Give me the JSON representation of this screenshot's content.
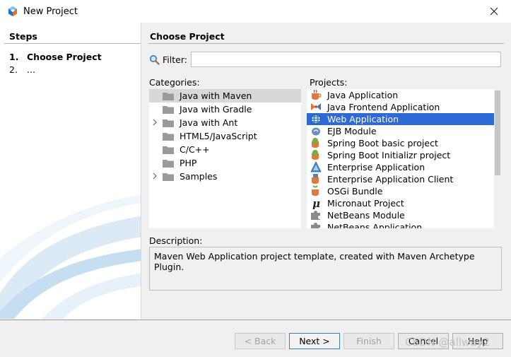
{
  "window": {
    "title": "New Project",
    "close_label": "✕"
  },
  "steps": {
    "header": "Steps",
    "items": [
      {
        "num": "1.",
        "label": "Choose Project"
      },
      {
        "num": "2.",
        "label": "..."
      }
    ]
  },
  "panel": {
    "title": "Choose Project",
    "filter_label": "Filter:",
    "filter_value": "",
    "categories_label": "Categories:",
    "projects_label": "Projects:",
    "description_label": "Description:",
    "description": "Maven Web Application project template, created with Maven Archetype Plugin."
  },
  "categories": [
    {
      "label": "Java with Maven",
      "expandable": false,
      "selected": true
    },
    {
      "label": "Java with Gradle",
      "expandable": false,
      "selected": false
    },
    {
      "label": "Java with Ant",
      "expandable": true,
      "selected": false
    },
    {
      "label": "HTML5/JavaScript",
      "expandable": false,
      "selected": false
    },
    {
      "label": "C/C++",
      "expandable": false,
      "selected": false
    },
    {
      "label": "PHP",
      "expandable": false,
      "selected": false
    },
    {
      "label": "Samples",
      "expandable": true,
      "selected": false
    }
  ],
  "projects": [
    {
      "label": "Java Application",
      "icon": "java-cup-icon",
      "selected": false
    },
    {
      "label": "Java Frontend Application",
      "icon": "frontend-icon",
      "selected": false
    },
    {
      "label": "Web Application",
      "icon": "globe-icon",
      "selected": true
    },
    {
      "label": "EJB Module",
      "icon": "ejb-bean-icon",
      "selected": false
    },
    {
      "label": "Spring Boot basic project",
      "icon": "spring-cup-icon",
      "selected": false
    },
    {
      "label": "Spring Boot Initializr project",
      "icon": "spring-cup-icon",
      "selected": false
    },
    {
      "label": "Enterprise Application",
      "icon": "triangle-icon",
      "selected": false
    },
    {
      "label": "Enterprise Application Client",
      "icon": "client-cup-icon",
      "selected": false
    },
    {
      "label": "OSGi Bundle",
      "icon": "osgi-icon",
      "selected": false
    },
    {
      "label": "Micronaut Project",
      "icon": "mu-icon",
      "selected": false
    },
    {
      "label": "NetBeans Module",
      "icon": "puzzle-icon",
      "selected": false
    },
    {
      "label": "NetBeans Application",
      "icon": "puzzle-icon",
      "selected": false
    }
  ],
  "buttons": {
    "back": "< Back",
    "next": "Next >",
    "finish": "Finish",
    "cancel": "Cancel",
    "help": "Help"
  },
  "watermark": "CSDN @allway2",
  "colors": {
    "selection": "#2e6ad6",
    "category_selection": "#d8d8d8",
    "accent_icon": "#3c7fb1"
  }
}
